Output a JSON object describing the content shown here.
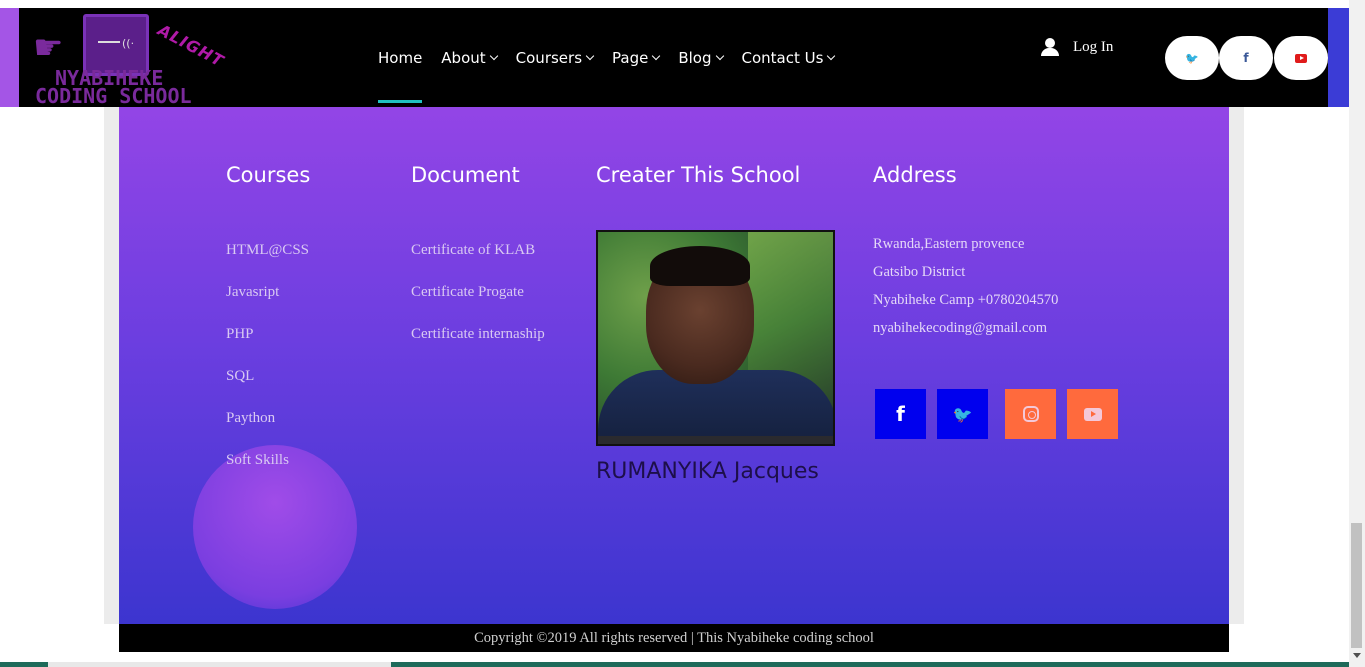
{
  "header": {
    "logo": {
      "top_text": "ALIGHT",
      "line1": "NYABIHEKE",
      "line2": "CODING SCHOOL"
    },
    "nav": [
      {
        "label": "Home",
        "active": true,
        "has_dropdown": false
      },
      {
        "label": "About",
        "active": false,
        "has_dropdown": true
      },
      {
        "label": "Coursers",
        "active": false,
        "has_dropdown": true
      },
      {
        "label": "Page",
        "active": false,
        "has_dropdown": true
      },
      {
        "label": "Blog",
        "active": false,
        "has_dropdown": true
      },
      {
        "label": "Contact Us",
        "active": false,
        "has_dropdown": true
      }
    ],
    "login_label": "Log In",
    "social": [
      {
        "icon": "twitter-icon",
        "glyph": "🐦"
      },
      {
        "icon": "facebook-icon",
        "glyph": "f"
      },
      {
        "icon": "youtube-icon",
        "glyph": ""
      }
    ]
  },
  "footer": {
    "courses": {
      "title": "Courses",
      "items": [
        "HTML@CSS",
        "Javasript",
        "PHP",
        "SQL",
        "Paython",
        "Soft Skills"
      ]
    },
    "document": {
      "title": "Document",
      "items": [
        "Certificate of KLAB",
        "Certificate Progate",
        "Certificate internaship"
      ]
    },
    "creator": {
      "title": "Creater This School",
      "name": "RUMANYIKA Jacques"
    },
    "address": {
      "title": "Address",
      "lines": [
        "Rwanda,Eastern provence",
        "Gatsibo District",
        "Nyabiheke Camp +0780204570",
        "nyabihekecoding@gmail.com"
      ],
      "social": [
        {
          "icon": "facebook-icon",
          "glyph": "f",
          "color": "#0000ee"
        },
        {
          "icon": "twitter-icon",
          "glyph": "🐦",
          "color": "#0000ee"
        },
        {
          "icon": "instagram-icon",
          "glyph": "",
          "color": "#ff6a3d"
        },
        {
          "icon": "youtube-icon",
          "glyph": "",
          "color": "#ff6a3d"
        }
      ]
    },
    "copyright": "Copyright ©2019 All rights reserved | This Nyabiheke coding school"
  },
  "colors": {
    "header_bg": "#000000",
    "nav_active_underline": "#21c0c0",
    "footer_gradient_top": "#9345e6",
    "footer_gradient_bottom": "#3c35cf",
    "social_blue": "#0000ee",
    "social_orange": "#ff6a3d"
  }
}
